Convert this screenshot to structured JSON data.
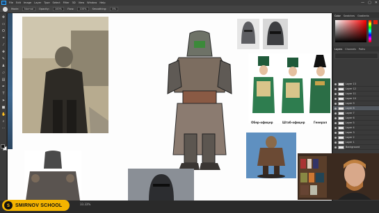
{
  "menu": {
    "items": [
      "File",
      "Edit",
      "Image",
      "Layer",
      "Type",
      "Select",
      "Filter",
      "3D",
      "View",
      "Window",
      "Help"
    ],
    "window_buttons": [
      "—",
      "▢",
      "✕"
    ]
  },
  "options": {
    "mode_label": "Mode:",
    "mode_value": "Normal",
    "opacity_label": "Opacity:",
    "opacity_value": "100%",
    "flow_label": "Flow:",
    "flow_value": "100%",
    "smoothing_label": "Smoothing:",
    "smoothing_value": "0%"
  },
  "panels": {
    "color_tabs": [
      "Color",
      "Swatches",
      "Gradients"
    ],
    "layer_tabs": [
      "Layers",
      "Channels",
      "Paths"
    ],
    "layers": [
      "Layer 13",
      "Layer 12",
      "Layer 11",
      "Layer 10",
      "Layer 9",
      "Layer 8",
      "Layer 7",
      "Layer 6",
      "Layer 5",
      "Layer 4",
      "Layer 3",
      "Layer 2",
      "Layer 1",
      "Background"
    ],
    "selected_layer_index": 5
  },
  "canvas": {
    "captions": {
      "officer": "Обер-офицер",
      "staff_officer": "Штаб-офицер",
      "general": "Генерал"
    }
  },
  "status": {
    "zoom": "33.33%"
  },
  "branding": {
    "school_name": "SMIRNOV SCHOOL",
    "badge_color": "#f4b400"
  },
  "colors": {
    "accent": "#31a8ff",
    "uniform_green": "#2e7d4f",
    "foreground": "#111111",
    "background": "#ffffff"
  },
  "icons": [
    "ps-logo-icon",
    "brush-icon",
    "move-icon",
    "marquee-icon",
    "lasso-icon",
    "crop-icon",
    "eyedropper-icon",
    "healing-icon",
    "brush-tool-icon",
    "stamp-icon",
    "eraser-icon",
    "gradient-icon",
    "pen-icon",
    "type-icon",
    "hand-icon",
    "zoom-icon",
    "eye-icon"
  ]
}
